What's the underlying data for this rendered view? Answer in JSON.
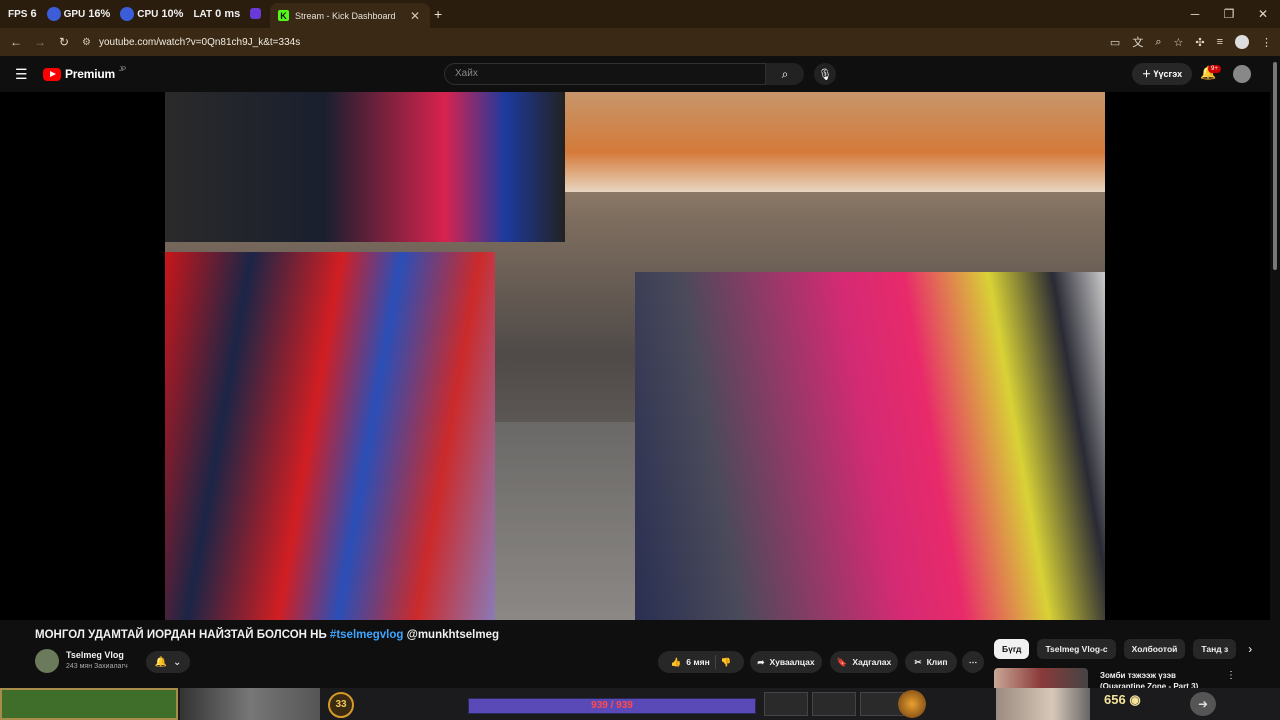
{
  "browser": {
    "overlay": {
      "fps_label": "FPS",
      "fps_value": "6",
      "gpu_label": "GPU",
      "gpu_value": "16%",
      "cpu_label": "CPU",
      "cpu_value": "10%",
      "lat_label": "LAT",
      "lat_value": "0 ms"
    },
    "active_tab_title": "Stream - Kick Dashboard",
    "url": "youtube.com/watch?v=0Qn81ch9J_k&t=334s"
  },
  "youtube": {
    "logo_text": "Premium",
    "logo_region": "JP",
    "search_placeholder": "Хайх",
    "create_label": "Үүсгэх",
    "notif_count": "9+"
  },
  "video": {
    "title_main": "МОНГОЛ УДАМТАЙ ИОРДАН НАЙЗТАЙ БОЛСОН НЬ ",
    "title_tag": "#tselmegvlog",
    "title_mention": " @munkhtselmeg",
    "channel_name": "Tselmeg Vlog",
    "channel_subs": "243 мян Захиалагч",
    "like_count": "6 мян",
    "share_label": "Хуваалцах",
    "save_label": "Хадгалах",
    "clip_label": "Клип"
  },
  "recommendations": {
    "chips": [
      "Бүгд",
      "Tselmeg Vlog-с",
      "Холбоотой",
      "Танд з"
    ],
    "first_title": "Зомби тэжээж үзэв (Quarantine Zone - Part 3)"
  },
  "game_hud": {
    "level": "33",
    "hp_text": "939 / 939",
    "gold": "656"
  }
}
